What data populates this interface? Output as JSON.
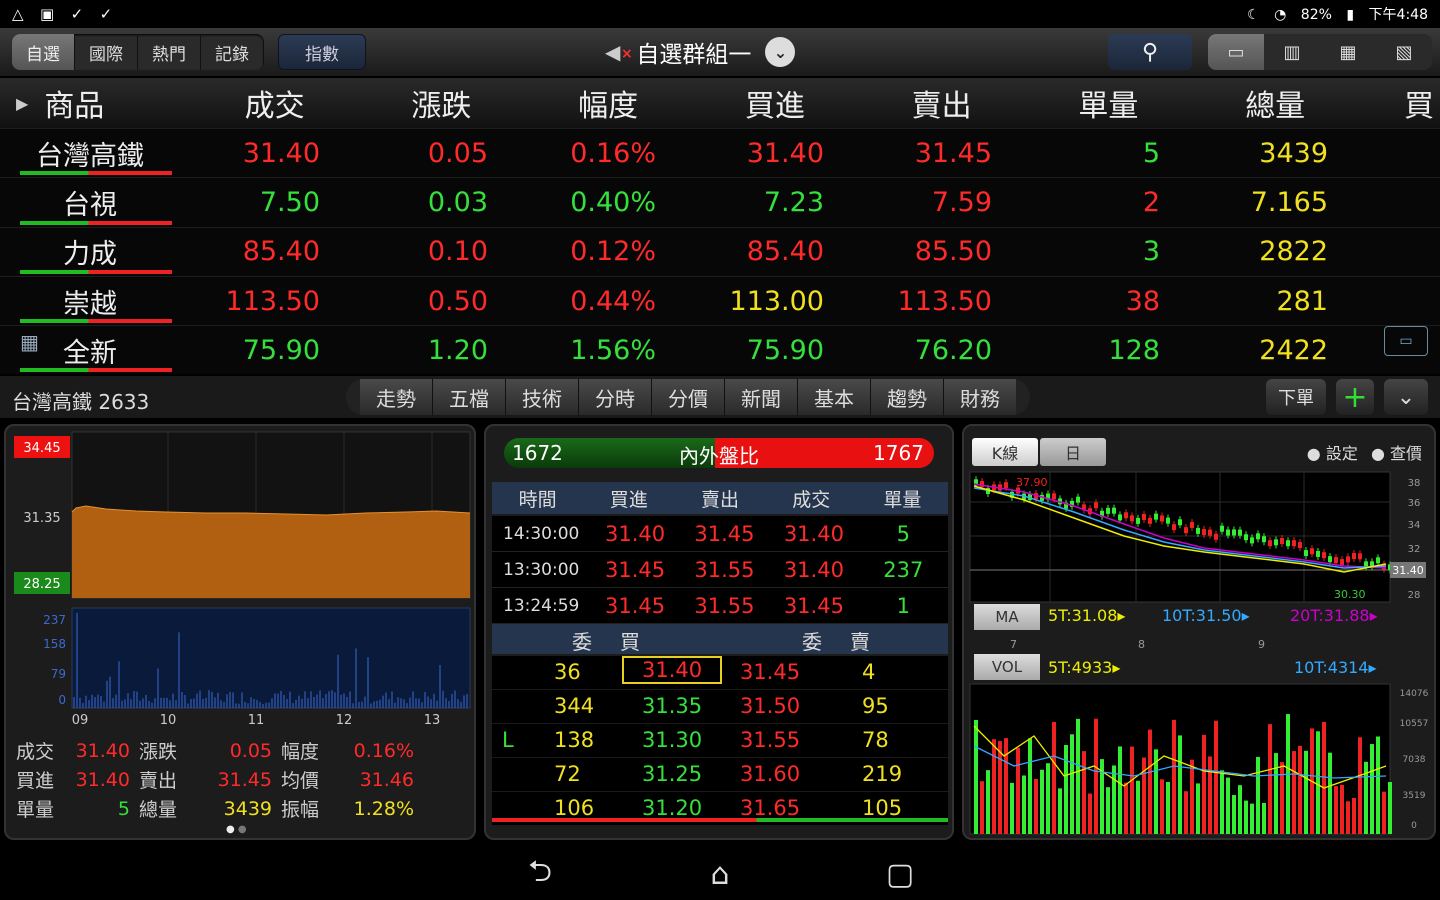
{
  "status": {
    "icons": [
      "△",
      "▣",
      "✓",
      "✓"
    ],
    "right_icons": [
      "☾",
      "wifi-icon",
      "battery-icon"
    ],
    "battery": "82%",
    "time": "下午4:48"
  },
  "topbar": {
    "tabs": [
      "自選",
      "國際",
      "熱門",
      "記錄"
    ],
    "active_tab": 0,
    "index_btn": "指數",
    "group_title": "自選群組一",
    "view_icons": [
      "▭",
      "▥",
      "▦",
      "▧"
    ]
  },
  "grid": {
    "headers": [
      "商品",
      "成交",
      "漲跌",
      "幅度",
      "買進",
      "賣出",
      "單量",
      "總量",
      "買"
    ],
    "rows": [
      {
        "name": "台灣高鐵",
        "price": "31.40",
        "change": "0.05",
        "pct": "0.16%",
        "bid": "31.40",
        "ask": "31.45",
        "vol": "5",
        "total": "3439",
        "colors": [
          "red",
          "red",
          "red",
          "red",
          "red",
          "green",
          "yellow"
        ]
      },
      {
        "name": "台視",
        "price": "7.50",
        "change": "0.03",
        "pct": "0.40%",
        "bid": "7.23",
        "ask": "7.59",
        "vol": "2",
        "total": "7.165",
        "colors": [
          "green",
          "green",
          "green",
          "green",
          "red",
          "red",
          "yellow"
        ]
      },
      {
        "name": "力成",
        "price": "85.40",
        "change": "0.10",
        "pct": "0.12%",
        "bid": "85.40",
        "ask": "85.50",
        "vol": "3",
        "total": "2822",
        "colors": [
          "red",
          "red",
          "red",
          "red",
          "red",
          "green",
          "yellow"
        ]
      },
      {
        "name": "崇越",
        "price": "113.50",
        "change": "0.50",
        "pct": "0.44%",
        "bid": "113.00",
        "ask": "113.50",
        "vol": "38",
        "total": "281",
        "colors": [
          "red",
          "red",
          "red",
          "yellow",
          "red",
          "red",
          "yellow"
        ]
      },
      {
        "name": "全新",
        "price": "75.90",
        "change": "1.20",
        "pct": "1.56%",
        "bid": "75.90",
        "ask": "76.20",
        "vol": "128",
        "total": "2422",
        "colors": [
          "green",
          "green",
          "green",
          "green",
          "green",
          "green",
          "yellow"
        ]
      }
    ]
  },
  "subbar": {
    "stock": "台灣高鐵 2633",
    "tabs": [
      "走勢",
      "五檔",
      "技術",
      "分時",
      "分價",
      "新聞",
      "基本",
      "趨勢",
      "財務"
    ],
    "order": "下單",
    "plus": "+",
    "down": "⌄"
  },
  "panel1": {
    "y_labels": [
      "34.45",
      "31.35",
      "28.25"
    ],
    "vol_labels": [
      "237",
      "158",
      "79",
      "0"
    ],
    "x_labels": [
      "09",
      "10",
      "11",
      "12",
      "13"
    ],
    "info": [
      [
        "成交",
        "31.40",
        "漲跌",
        "0.05",
        "幅度",
        "0.16%"
      ],
      [
        "買進",
        "31.40",
        "賣出",
        "31.45",
        "均價",
        "31.46"
      ],
      [
        "單量",
        "5",
        "總量",
        "3439",
        "振幅",
        "1.28%"
      ]
    ]
  },
  "panel2": {
    "inner": "1672",
    "ratio_label": "內外盤比",
    "outer": "1767",
    "tick_headers": [
      "時間",
      "買進",
      "賣出",
      "成交",
      "單量"
    ],
    "ticks": [
      [
        "14:30:00",
        "31.40",
        "31.45",
        "31.40",
        "5"
      ],
      [
        "13:30:00",
        "31.45",
        "31.55",
        "31.40",
        "237"
      ],
      [
        "13:24:59",
        "31.45",
        "31.55",
        "31.45",
        "1"
      ]
    ],
    "book_headers": [
      "委",
      "買",
      "委",
      "賣"
    ],
    "book": [
      [
        "",
        "36",
        "31.40",
        "31.45",
        "4"
      ],
      [
        "",
        "344",
        "31.35",
        "31.50",
        "95"
      ],
      [
        "L",
        "138",
        "31.30",
        "31.55",
        "78"
      ],
      [
        "",
        "72",
        "31.25",
        "31.60",
        "219"
      ],
      [
        "",
        "106",
        "31.20",
        "31.65",
        "105"
      ]
    ]
  },
  "panel3": {
    "kbtn": "K線",
    "day": "日",
    "settings": "設定",
    "query": "查價",
    "high": "37.90",
    "low": "30.30",
    "last": "31.40",
    "ma_label": "MA",
    "ma5": "5T:31.08",
    "ma10": "10T:31.50",
    "ma20": "20T:31.88",
    "x_labels": [
      "7",
      "8",
      "9"
    ],
    "vol_label": "VOL",
    "vol5": "5T:4933",
    "vol10": "10T:4314",
    "vol_axis": [
      "14076",
      "10557",
      "7038",
      "3519",
      "0"
    ],
    "price_axis": [
      "38",
      "36",
      "34",
      "32",
      "30",
      "28"
    ]
  },
  "nav": [
    "⮌",
    "⌂",
    "▢"
  ]
}
